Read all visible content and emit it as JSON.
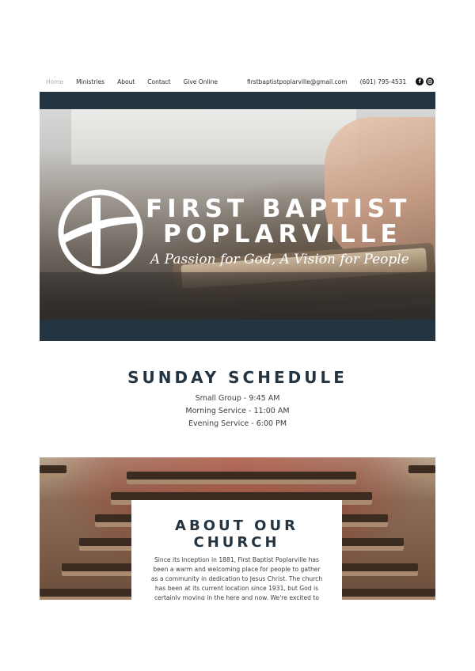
{
  "nav": {
    "items": [
      "Home",
      "Ministries",
      "About",
      "Contact",
      "Give Online"
    ],
    "active": "Home"
  },
  "contact": {
    "email": "firstbaptistpoplarville@gmail.com",
    "phone": "(601) 795-4531",
    "social_icons": [
      "facebook-icon",
      "instagram-icon"
    ]
  },
  "hero": {
    "title_line1": "FIRST BAPTIST",
    "title_line2": "POPLARVILLE",
    "tagline": "A Passion for God, A Vision for People"
  },
  "schedule": {
    "title": "SUNDAY SCHEDULE",
    "items": [
      "Small Group - 9:45 AM",
      "Morning Service - 11:00 AM",
      "Evening Service - 6:00 PM"
    ]
  },
  "about": {
    "title": "ABOUT OUR CHURCH",
    "body": "Since its inception in 1881, First Baptist Poplarville has been a warm and welcoming place for people to gather as a community in dedication to Jesus Christ. The church has been at its current location since 1931, but God is certainly moving in the here and now. We're excited to"
  },
  "colors": {
    "navy": "#243441",
    "nav_active": "#a9b0b5"
  }
}
